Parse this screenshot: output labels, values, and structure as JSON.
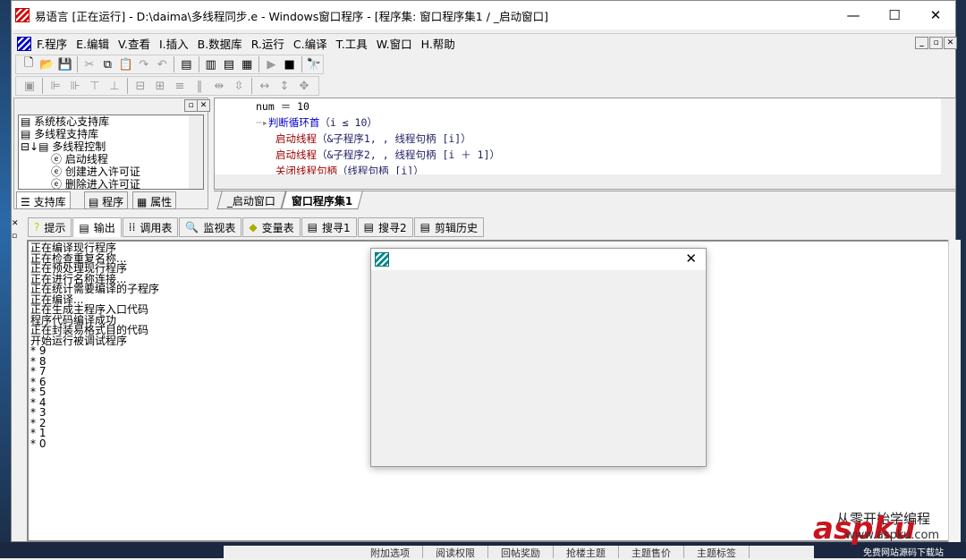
{
  "title": "易语言 [正在运行] - D:\\daima\\多线程同步.e - Windows窗口程序 - [程序集: 窗口程序集1 / _启动窗口]",
  "menu": [
    "F.程序",
    "E.编辑",
    "V.查看",
    "I.插入",
    "B.数据库",
    "R.运行",
    "C.编译",
    "T.工具",
    "W.窗口",
    "H.帮助"
  ],
  "tree": [
    "系统核心支持库",
    "多线程支持库",
    "多线程控制",
    "启动线程",
    "创建进入许可证",
    "删除进入许可证"
  ],
  "left_tabs": [
    "支持库",
    "程序",
    "属性"
  ],
  "code": {
    "l1": "num ＝ 10",
    "l2a": "判断循环首",
    "l2b": "（i ≤ 10）",
    "l3a": "启动线程",
    "l3b": "（&子程序1, , 线程句柄 [i]）",
    "l4a": "启动线程",
    "l4b": "（&子程序2, , 线程句柄 [i ＋ 1]）",
    "l5a": "关闭线程句柄",
    "l5b": "（线程句柄 [i]）"
  },
  "code_tabs": [
    "_启动窗口",
    "窗口程序集1"
  ],
  "output_tabs": [
    "提示",
    "输出",
    "调用表",
    "监视表",
    "变量表",
    "搜寻1",
    "搜寻2",
    "剪辑历史"
  ],
  "output_text": "正在编译现行程序\n正在检查重复名称...\n正在预处理现行程序\n正在进行名称连接...\n正在统计需要编译的子程序\n正在编译...\n正在生成主程序入口代码\n程序代码编译成功\n正在封装易格式目的代码\n开始运行被调试程序\n* 9\n* 8\n* 7\n* 6\n* 5\n* 4\n* 3\n* 2\n* 1\n* 0",
  "bottom_tabs": [
    "附加选项",
    "阅读权限",
    "回帖奖励",
    "抢楼主题",
    "主题售价",
    "主题标签"
  ],
  "watermark": {
    "line1": "从零开始学编程",
    "brand": "aspku",
    "domain": "www.aspku.com",
    "tagline": "免费网站源码下载站"
  }
}
